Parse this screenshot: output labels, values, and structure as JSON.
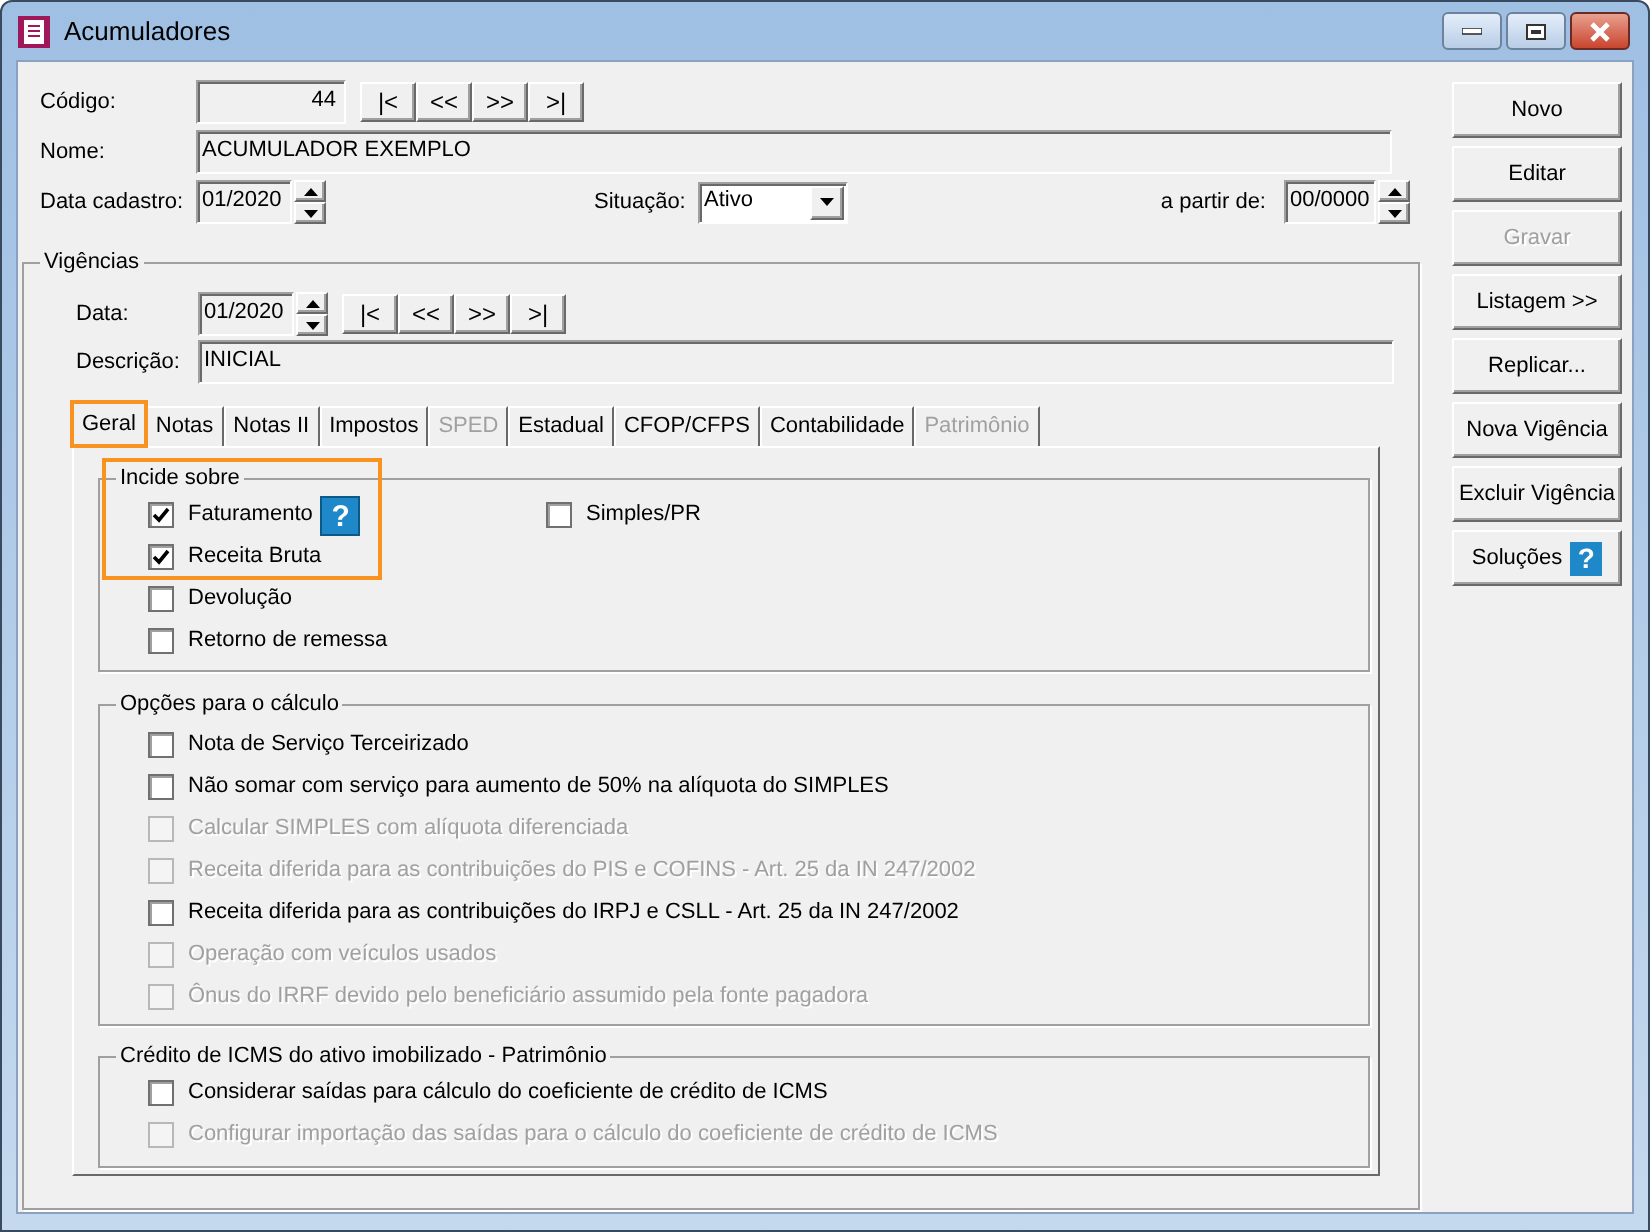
{
  "window": {
    "title": "Acumuladores"
  },
  "codigo": {
    "label": "Código:",
    "value": "44"
  },
  "nav_buttons": [
    "|<",
    "<<",
    ">>",
    ">|"
  ],
  "nome": {
    "label": "Nome:",
    "value": "ACUMULADOR EXEMPLO"
  },
  "data_cadastro": {
    "label": "Data cadastro:",
    "value": "01/2020"
  },
  "situacao": {
    "label": "Situação:",
    "value": "Ativo"
  },
  "a_partir_de": {
    "label": "a partir de:",
    "value": "00/0000"
  },
  "vigencias": {
    "title": "Vigências",
    "data": {
      "label": "Data:",
      "value": "01/2020"
    },
    "nav_buttons": [
      "|<",
      "<<",
      ">>",
      ">|"
    ],
    "descricao": {
      "label": "Descrição:",
      "value": "INICIAL"
    }
  },
  "tabs": [
    {
      "label": "Geral",
      "selected": true,
      "disabled": false,
      "highlighted": true
    },
    {
      "label": "Notas",
      "selected": false,
      "disabled": false,
      "highlighted": false
    },
    {
      "label": "Notas II",
      "selected": false,
      "disabled": false,
      "highlighted": false
    },
    {
      "label": "Impostos",
      "selected": false,
      "disabled": false,
      "highlighted": false
    },
    {
      "label": "SPED",
      "selected": false,
      "disabled": true,
      "highlighted": false
    },
    {
      "label": "Estadual",
      "selected": false,
      "disabled": false,
      "highlighted": false
    },
    {
      "label": "CFOP/CFPS",
      "selected": false,
      "disabled": false,
      "highlighted": false
    },
    {
      "label": "Contabilidade",
      "selected": false,
      "disabled": false,
      "highlighted": false
    },
    {
      "label": "Patrimônio",
      "selected": false,
      "disabled": true,
      "highlighted": false
    }
  ],
  "incide_sobre": {
    "title": "Incide sobre",
    "left_items": [
      {
        "label": "Faturamento",
        "checked": true,
        "disabled": false,
        "highlighted": true,
        "help": "?"
      },
      {
        "label": "Receita Bruta",
        "checked": true,
        "disabled": false,
        "highlighted": true
      },
      {
        "label": "Devolução",
        "checked": false,
        "disabled": false,
        "highlighted": false
      },
      {
        "label": "Retorno de remessa",
        "checked": false,
        "disabled": false,
        "highlighted": false
      }
    ],
    "right_items": [
      {
        "label": "Simples/PR",
        "checked": false,
        "disabled": false
      }
    ]
  },
  "opcoes_calculo": {
    "title": "Opções para o cálculo",
    "items": [
      {
        "label": "Nota de Serviço Terceirizado",
        "checked": false,
        "disabled": false
      },
      {
        "label": "Não somar com serviço para aumento de 50% na alíquota do SIMPLES",
        "checked": false,
        "disabled": false
      },
      {
        "label": "Calcular SIMPLES com alíquota diferenciada",
        "checked": false,
        "disabled": true
      },
      {
        "label": "Receita diferida para as contribuições do PIS e COFINS -  Art. 25 da IN 247/2002",
        "checked": false,
        "disabled": true
      },
      {
        "label": "Receita diferida para as contribuições do IRPJ e CSLL - Art. 25 da IN 247/2002",
        "checked": false,
        "disabled": false
      },
      {
        "label": "Operação com veículos usados",
        "checked": false,
        "disabled": true
      },
      {
        "label": "Ônus do IRRF devido pelo beneficiário assumido pela fonte pagadora",
        "checked": false,
        "disabled": true
      }
    ]
  },
  "credito_icms": {
    "title": "Crédito de ICMS do ativo imobilizado - Patrimônio",
    "items": [
      {
        "label": "Considerar saídas para cálculo do coeficiente de crédito de ICMS",
        "checked": false,
        "disabled": false
      },
      {
        "label": "Configurar importação das saídas para o cálculo do coeficiente de crédito de ICMS",
        "checked": false,
        "disabled": true
      }
    ]
  },
  "side_buttons": [
    {
      "label": "Novo",
      "disabled": false
    },
    {
      "label": "Editar",
      "disabled": false
    },
    {
      "label": "Gravar",
      "disabled": true
    },
    {
      "label": "Listagem >>",
      "disabled": false
    },
    {
      "label": "Replicar...",
      "disabled": false
    },
    {
      "label": "Nova Vigência",
      "disabled": false
    },
    {
      "label": "Excluir Vigência",
      "disabled": false
    },
    {
      "label": "Soluções",
      "disabled": false,
      "help": "?"
    }
  ]
}
